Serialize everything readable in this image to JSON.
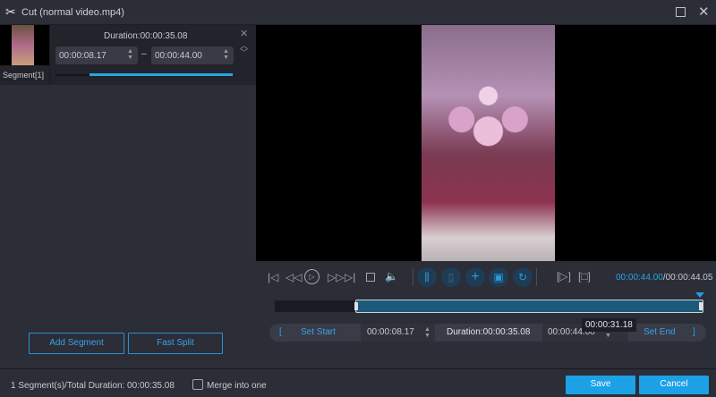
{
  "window": {
    "title": "Cut (normal video.mp4)"
  },
  "segment": {
    "label": "Segment[1]",
    "duration": "Duration:00:00:35.08",
    "start": "00:00:08.17",
    "end": "00:00:44.00",
    "dash": "–",
    "progress_start": 0.19,
    "progress_end": 1.0
  },
  "left_buttons": {
    "add_segment": "Add Segment",
    "fast_split": "Fast Split"
  },
  "player": {
    "current_time": "00:00:44.00",
    "total_time": "/00:00:44.05"
  },
  "timeline": {
    "selection_start_fraction": 0.185,
    "selection_end_fraction": 1.0,
    "tooltip": "00:00:31.18"
  },
  "cut_bar": {
    "open_bracket": "[",
    "set_start": "Set Start",
    "start": "00:00:08.17",
    "duration": "Duration:00:00:35.08",
    "end": "00:00:44.00",
    "set_end": "Set End",
    "close_bracket": "]"
  },
  "footer": {
    "summary": "1 Segment(s)/Total Duration: 00:00:35.08",
    "merge_label": "Merge into one",
    "merge_checked": false,
    "save": "Save",
    "cancel": "Cancel"
  },
  "colors": {
    "accent": "#1ca0e6",
    "background": "#2b2d37"
  }
}
